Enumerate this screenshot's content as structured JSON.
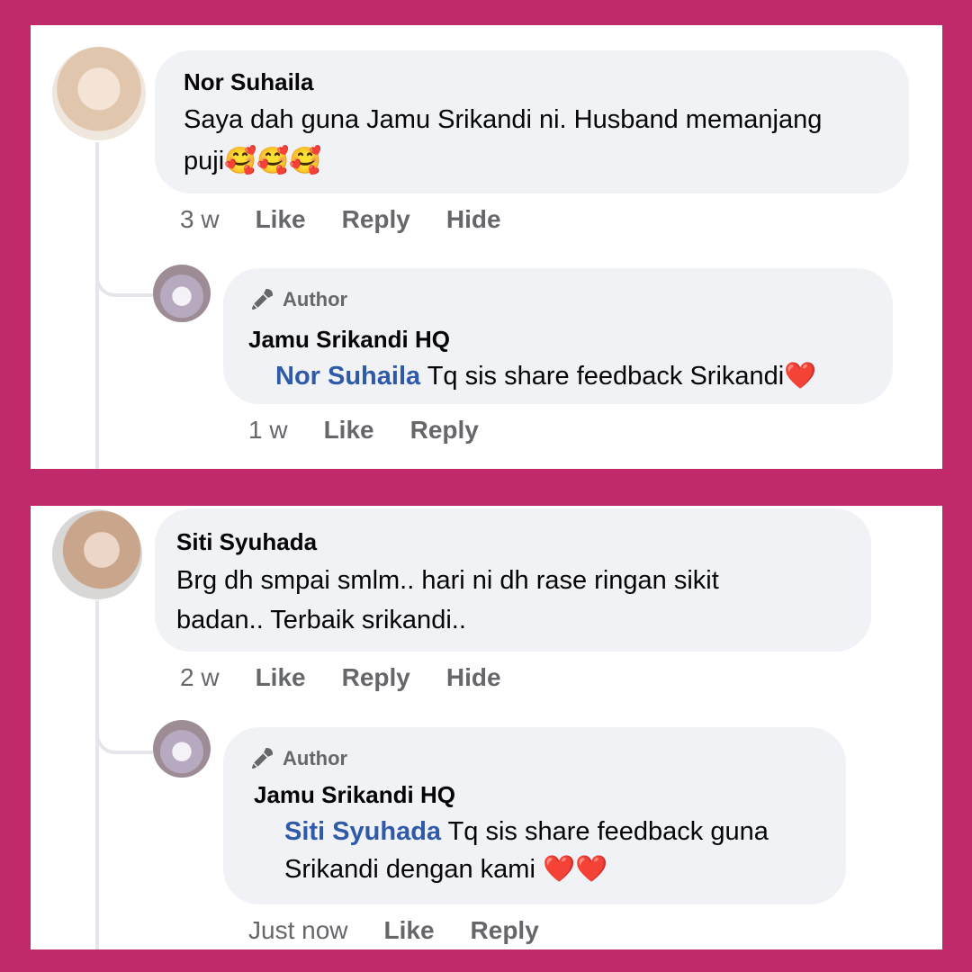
{
  "threads": [
    {
      "comment": {
        "name": "Nor Suhaila",
        "line1": "Saya dah guna Jamu Srikandi ni. Husband memanjang",
        "line2": "puji🥰🥰🥰",
        "time": "3 w",
        "like": "Like",
        "reply": "Reply",
        "hide": "Hide"
      },
      "reply": {
        "badge": "Author",
        "name": "Jamu Srikandi HQ",
        "mention": "Nor Suhaila",
        "line1": " Tq sis share feedback Srikandi❤️",
        "time": "1 w",
        "like": "Like",
        "reply": "Reply"
      }
    },
    {
      "comment": {
        "name": "Siti Syuhada",
        "line1": "Brg dh smpai smlm.. hari ni dh rase ringan sikit",
        "line2": "badan.. Terbaik srikandi..",
        "time": "2 w",
        "like": "Like",
        "reply": "Reply",
        "hide": "Hide"
      },
      "reply": {
        "badge": "Author",
        "name": "Jamu Srikandi HQ",
        "mention": "Siti Syuhada",
        "line1": " Tq sis share feedback guna",
        "line2": "Srikandi dengan kami ❤️❤️",
        "time": "Just now",
        "like": "Like",
        "reply": "Reply"
      }
    }
  ]
}
